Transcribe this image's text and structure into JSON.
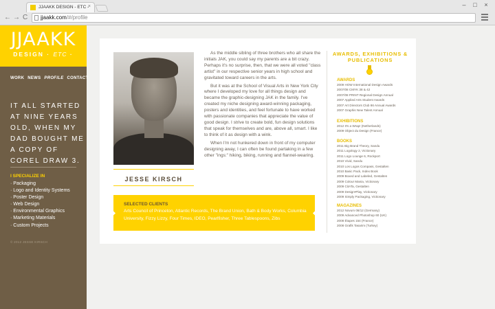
{
  "browser": {
    "tab_title": "JJAAKK DESIGN - ETC -",
    "tab_close": "×",
    "url_host": "jjaakk.com",
    "url_path": "/#/profile",
    "back_glyph": "←",
    "forward_glyph": "→",
    "reload_glyph": "C",
    "star_glyph": "☆",
    "min_glyph": "–",
    "max_glyph": "□",
    "close_glyph": "×"
  },
  "sidebar": {
    "logo_main": "JJAAKK",
    "logo_sub": "DESIGN",
    "logo_etc": "ETC",
    "logo_dash": "·",
    "nav": [
      "WORK",
      "NEWS",
      "PROFILE",
      "CONTACT"
    ],
    "active_nav": "PROFILE",
    "intro": "IT ALL STARTED AT NINE YEARS OLD, WHEN MY DAD BOUGHT ME A COPY OF COREL DRAW 3.",
    "specialize_title": "I SPECIALIZE IN",
    "specialties": [
      "· Packaging",
      "· Logo and Identity Systems",
      "· Poster Design",
      "· Web Design",
      "· Environmental Graphics",
      "· Marketing Materials",
      "· Custom Projects"
    ],
    "copyright": "© 2012 JESSE KIRSCH"
  },
  "profile": {
    "name": "JESSE KIRSCH",
    "bio": [
      "As the middle sibling of three brothers who all share the initials JAK, you could say my parents are a bit crazy. Perhaps it's no surprise, then, that we were all voted \"class artist\" in our respective senior years in high school and gravitated toward careers in the arts.",
      "But it was at the School of Visual Arts in New York City where I developed my love for all things design and became the graphic-designing JAK in the family. I've created my niche designing award-winning packaging, posters and identities, and feel fortunate to have worked with passionate companies that appreciate the value of good design. I strive to create bold, fun design solutions that speak for themselves and are, above all, smart. I like to think of it as design with a wink.",
      "When I'm not hunkered down in front of my computer designing away, I can often be found partaking in a few other \"ings:\" hiking, biking, running and flannel-wearing."
    ],
    "clients_title": "SELECTED CLIENTS",
    "clients": "Arts Council of Princeton, Atlantic Records, The Brand Union, Bath & Body Works, Columbia University, Fizzy Lizzy, Four Times, IDEO, Pearlfisher, Three Tablespoons, Zibs"
  },
  "awards": {
    "title": "AWARDS, EXHIBITIONS & PUBLICATIONS",
    "sections": [
      {
        "heading": "AWARDS",
        "items": [
          "2009 HOW International Design Awards",
          "2007/08 CMYK 38 & 42",
          "2007/08 PRINT Regional Design Annual",
          "2007 Applied Arts Student Awards",
          "2007 Art Directors Club 86 Annual Awards",
          "2007 Graphis New Talent Annual"
        ]
      },
      {
        "heading": "EXHIBITIONS",
        "items": [
          "2012 It's a Wrap! (Netherlands)",
          "2009 Object du Design (France)"
        ]
      },
      {
        "heading": "BOOKS",
        "items": [
          "2011 Big Brand Theory, Sandu",
          "2011 Logology 2, Victionary",
          "2011 Logo Lounge 6, Rockport",
          "2010 Vivid, Sandu",
          "2010 Los Logos Compass, Gestalten",
          "2010 Basic Pack, Index Book",
          "2009 Boxed and Labeled, Gestalten",
          "2009 Colour Mania, Victionary",
          "2009 CitATa, Gestalten",
          "2009 Design•Play, Victionary",
          "2009 Simply Packaging, Victionary"
        ]
      },
      {
        "heading": "MAGAZINES",
        "items": [
          "2012 Novum 08/12 (Germany)",
          "2009 Advanced Photoshop 60 (UK)",
          "2008 Étapes 154 (France)",
          "2008 Grafik Tasarim (Turkey)"
        ]
      }
    ]
  }
}
